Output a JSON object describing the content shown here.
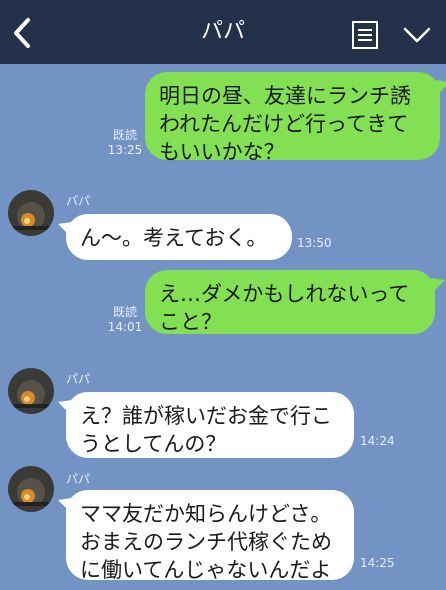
{
  "header": {
    "title": "パパ"
  },
  "messages": [
    {
      "direction": "out",
      "text": "明日の昼、友達にランチ誘われたんだけど行ってきてもいいかな？",
      "read": "既読",
      "time": "13:25"
    },
    {
      "direction": "in",
      "sender": "パパ",
      "text": "ん〜。考えておく。",
      "time": "13:50"
    },
    {
      "direction": "out",
      "text": "え…ダメかもしれないってこと？",
      "read": "既読",
      "time": "14:01"
    },
    {
      "direction": "in",
      "sender": "パパ",
      "text": "え？誰が稼いだお金で行こうとしてんの？",
      "time": "14:24"
    },
    {
      "direction": "in",
      "sender": "パパ",
      "text": "ママ友だか知らんけどさ。おまえのランチ代稼ぐために働いてんじゃないんだよ",
      "time": "14:25"
    }
  ],
  "icons": {
    "back": "chevron-left-icon",
    "menu": "note-list-icon",
    "more": "chevron-down-icon"
  },
  "colors": {
    "header_bg": "#25304a",
    "chat_bg": "#7393c4",
    "outgoing_bubble": "#83e052",
    "incoming_bubble": "#ffffff"
  }
}
